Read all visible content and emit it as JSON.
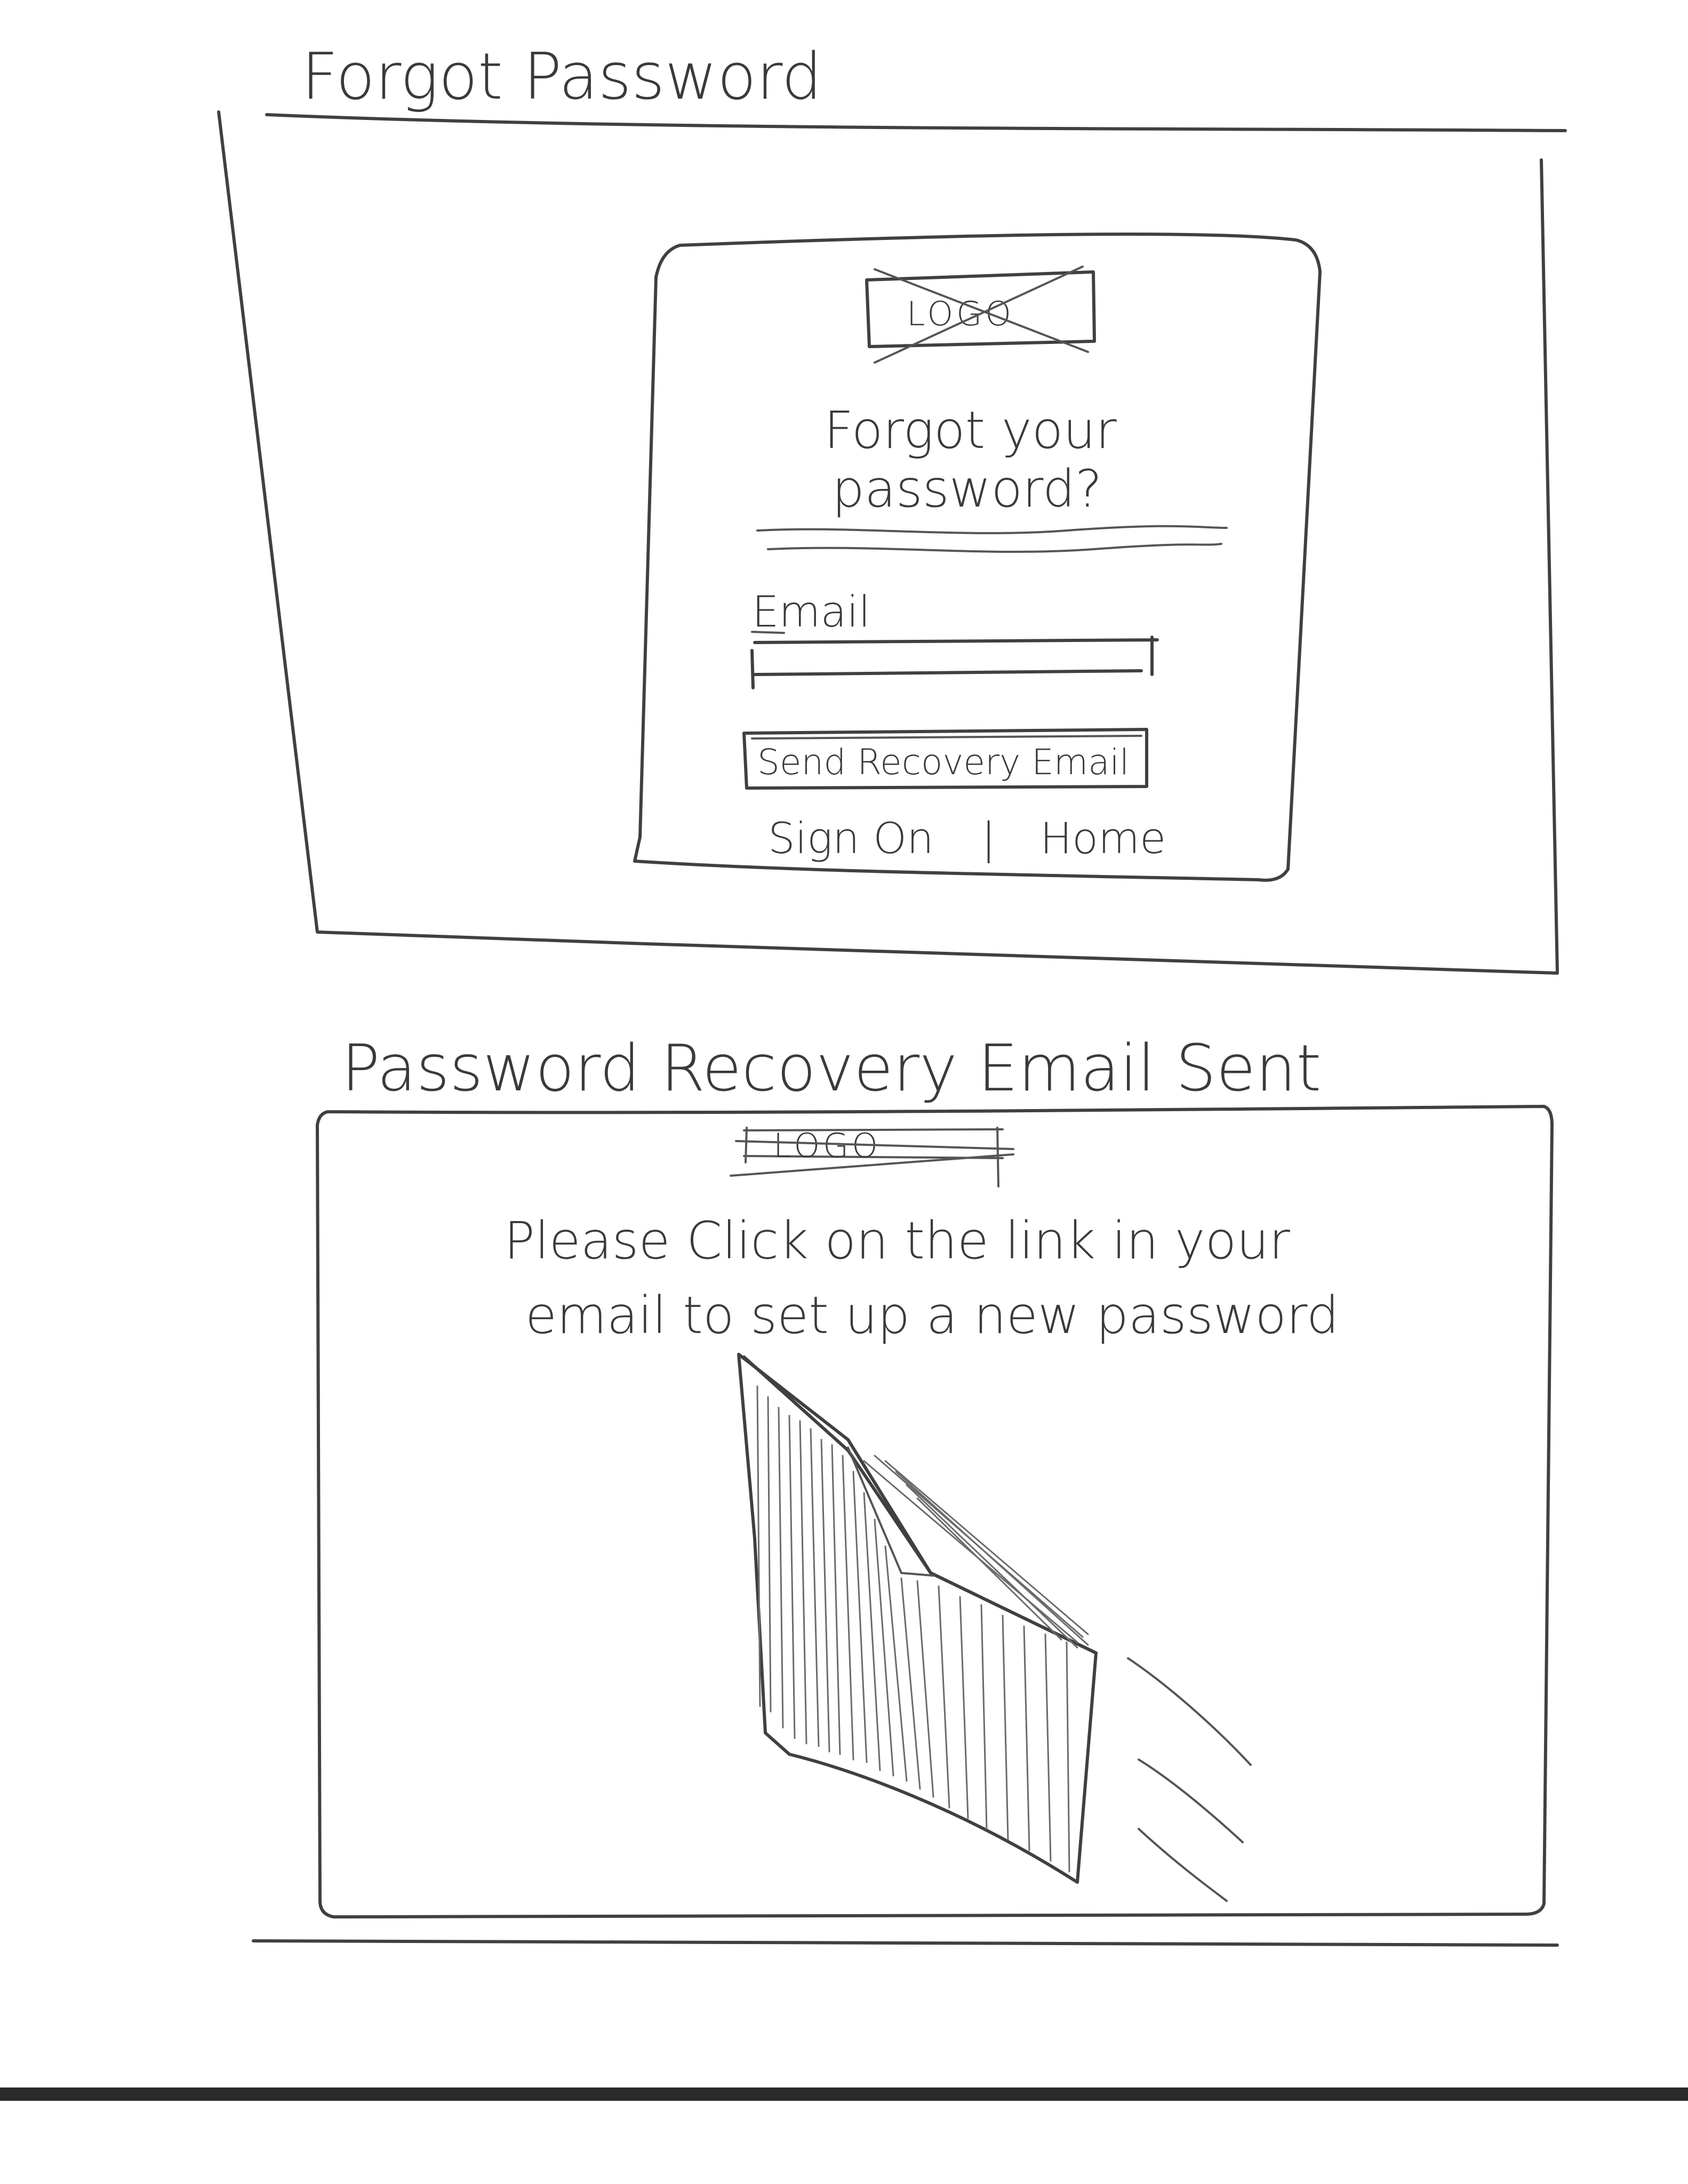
{
  "screens": {
    "forgot_password": {
      "title": "Forgot Password",
      "logo_label": "LOGO",
      "heading_line1": "Forgot your",
      "heading_line2": "password?",
      "email_label": "Email",
      "email_value": "",
      "send_button_label": "Send Recovery Email",
      "link_sign_on": "Sign On",
      "link_separator": "|",
      "link_home": "Home"
    },
    "recovery_sent": {
      "title": "Password Recovery Email Sent",
      "logo_label": "LOGO",
      "message_line1": "Please Click on the link in your",
      "message_line2": "email to set up a new password",
      "illustration_icon": "envelope-sketch-icon"
    }
  }
}
